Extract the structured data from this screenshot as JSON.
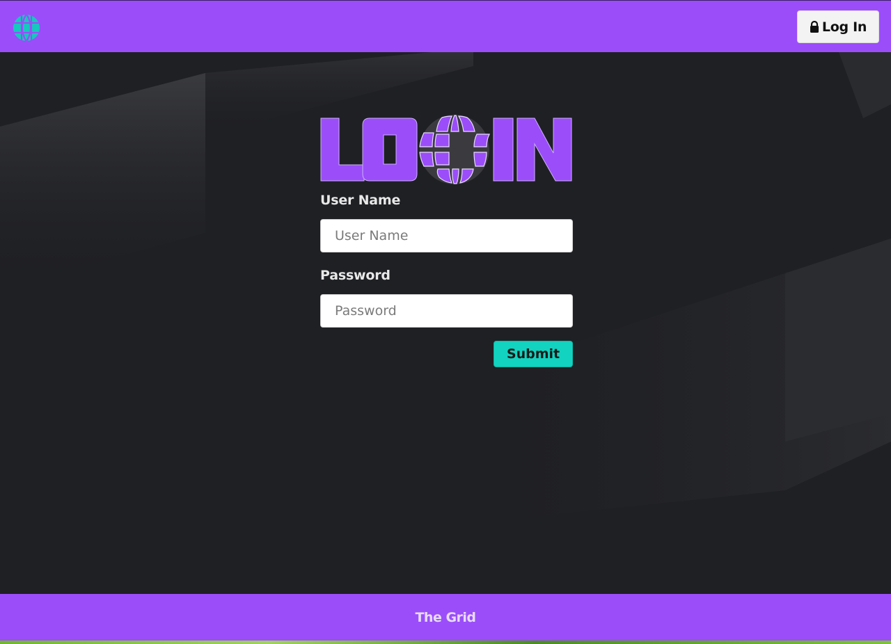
{
  "header": {
    "logo_icon": "globe-grid-icon",
    "login_button_label": "Log In",
    "login_button_icon": "lock-icon"
  },
  "main": {
    "title_logo_text": "LOGIN",
    "username": {
      "label": "User Name",
      "placeholder": "User Name",
      "value": ""
    },
    "password": {
      "label": "Password",
      "placeholder": "Password",
      "value": ""
    },
    "submit_label": "Submit"
  },
  "footer": {
    "text": "The Grid"
  },
  "colors": {
    "brand_purple": "#9b4dfa",
    "accent_teal": "#12d3c0",
    "background": "#1f2024"
  }
}
